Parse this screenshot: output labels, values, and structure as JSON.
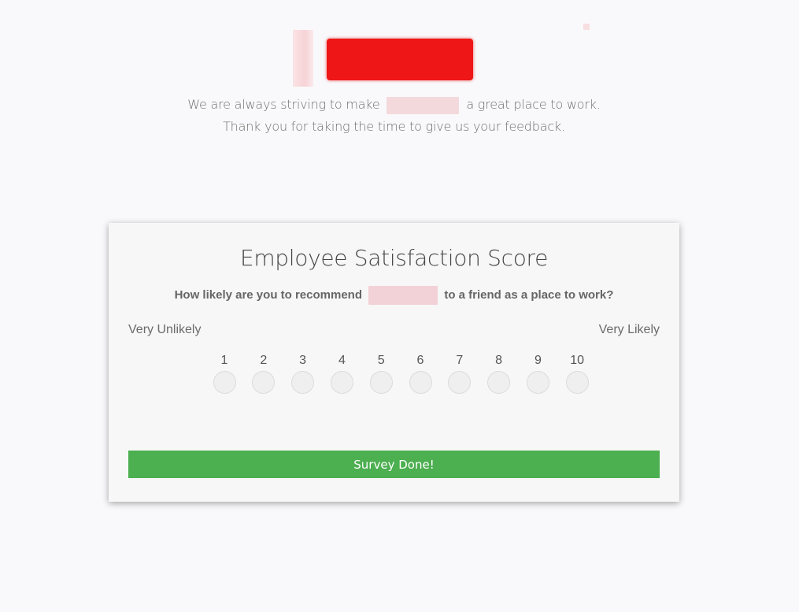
{
  "header": {
    "intro_part1": "We are always striving to make",
    "intro_part2": "a great place to work.",
    "intro_line2": "Thank you for taking the time to give us your feedback."
  },
  "survey": {
    "title": "Employee Satisfaction Score",
    "question_part1": "How likely are you to recommend",
    "question_part2": "to a friend as a place to work?",
    "scale_low_label": "Very Unlikely",
    "scale_high_label": "Very Likely",
    "options": [
      "1",
      "2",
      "3",
      "4",
      "5",
      "6",
      "7",
      "8",
      "9",
      "10"
    ],
    "submit_label": "Survey Done!"
  },
  "colors": {
    "submit_button": "#4caf50",
    "logo_block": "#ee1616",
    "redaction": "#f4d9dc"
  }
}
